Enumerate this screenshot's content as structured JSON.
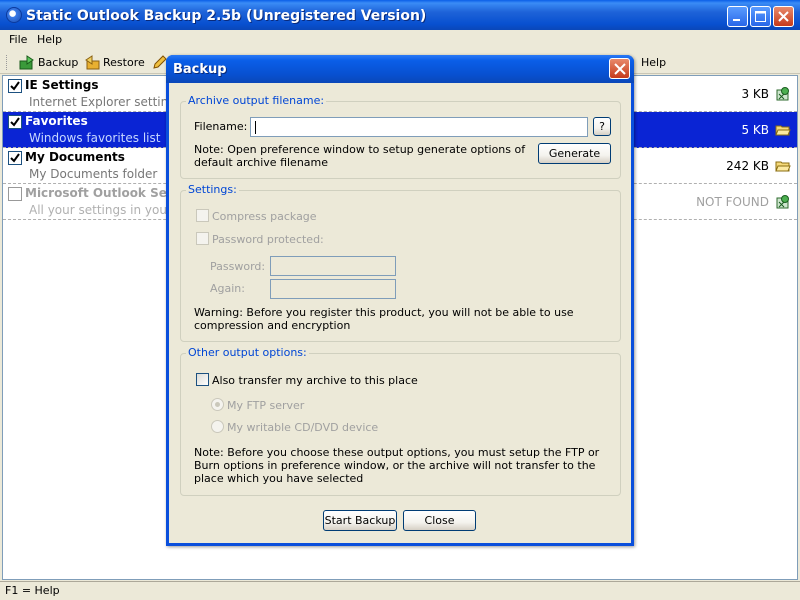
{
  "window": {
    "title": "Static Outlook Backup 2.5b (Unregistered Version)"
  },
  "menu": [
    "File",
    "Help"
  ],
  "toolbar": {
    "backup_label": "Backup",
    "restore_label": "Restore",
    "help_label": "Help"
  },
  "items": [
    {
      "name": "IE Settings",
      "desc": "Internet Explorer settings",
      "size": "3 KB",
      "checked": true,
      "selected": false,
      "disabled": false,
      "icon": "settings-icon"
    },
    {
      "name": "Favorites",
      "desc": "Windows favorites list",
      "size": "5 KB",
      "checked": true,
      "selected": true,
      "disabled": false,
      "icon": "folder-open-icon"
    },
    {
      "name": "My Documents",
      "desc": "My Documents folder",
      "size": "242 KB",
      "checked": true,
      "selected": false,
      "disabled": false,
      "icon": "folder-open-icon"
    },
    {
      "name": "Microsoft Outlook Sett",
      "desc": "All your settings in your O",
      "size": "NOT FOUND",
      "checked": false,
      "selected": false,
      "disabled": true,
      "icon": "settings-icon"
    }
  ],
  "status": {
    "text": "F1 = Help"
  },
  "dialog": {
    "title": "Backup",
    "archive_group": "Archive output filename:",
    "filename_label": "Filename:",
    "filename_value": "",
    "browse_label": "?",
    "archive_note": "Note: Open preference window to setup generate options of default archive filename",
    "generate_label": "Generate",
    "settings_group": "Settings:",
    "compress_label": "Compress package",
    "password_protected_label": "Password protected:",
    "password_label": "Password:",
    "again_label": "Again:",
    "warning": "Warning: Before you register this product, you will not be able to use compression and encryption",
    "other_group": "Other output options:",
    "transfer_label": "Also transfer my archive to this place",
    "ftp_label": "My FTP server",
    "cd_label": "My writable CD/DVD device",
    "other_note": "Note: Before you choose these output options, you must setup the FTP or Burn options in preference window, or the archive will not transfer to the place which you have selected",
    "start_label": "Start Backup",
    "close_label": "Close"
  }
}
